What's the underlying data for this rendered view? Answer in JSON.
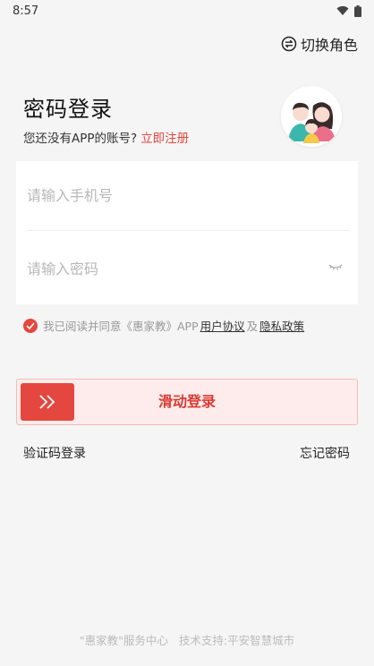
{
  "status_bar": {
    "time": "8:57"
  },
  "header": {
    "switch_role_label": "切换角色"
  },
  "login": {
    "title": "密码登录",
    "no_account_text": "您还没有APP的账号?",
    "register_link": "立即注册"
  },
  "form": {
    "phone_placeholder": "请输入手机号",
    "password_placeholder": "请输入密码"
  },
  "agreement": {
    "prefix": "我已阅读并同意《惠家教》APP",
    "user_agreement": "用户协议",
    "and": "及",
    "privacy_policy": "隐私政策",
    "checked": true
  },
  "slider": {
    "label": "滑动登录"
  },
  "links": {
    "sms_login": "验证码登录",
    "forgot_password": "忘记密码"
  },
  "footer": {
    "service": "\"惠家教\"服务中心",
    "support": "技术支持:平安智慧城市"
  },
  "colors": {
    "accent": "#e4473f",
    "background": "#f5f5f5"
  }
}
